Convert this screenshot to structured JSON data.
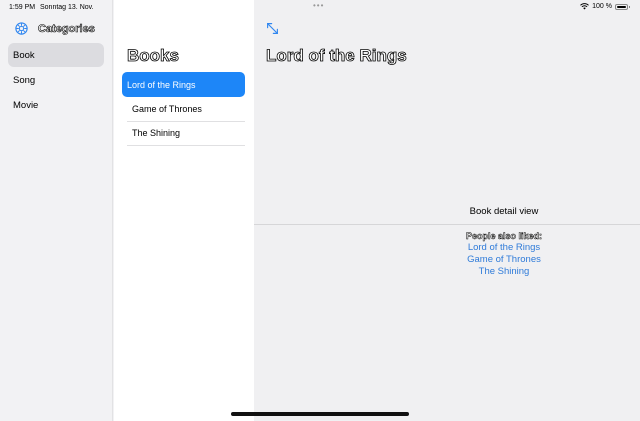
{
  "status_bar": {
    "time": "1:59 PM",
    "date": "Sonntag 13. Nov.",
    "battery": "100 %",
    "multitask_dots": "•••"
  },
  "sidebar": {
    "title": "Categories",
    "icon": "gear-icon",
    "items": [
      {
        "label": "Book",
        "selected": true
      },
      {
        "label": "Song",
        "selected": false
      },
      {
        "label": "Movie",
        "selected": false
      }
    ]
  },
  "books": {
    "title": "Books",
    "items": [
      {
        "label": "Lord of the Rings",
        "selected": true
      },
      {
        "label": "Game of Thrones",
        "selected": false
      },
      {
        "label": "The Shining",
        "selected": false
      }
    ]
  },
  "detail": {
    "title": "Lord of the Rings",
    "caption": "Book detail view",
    "related_label": "People also liked:",
    "related": [
      "Lord of the Rings",
      "Game of Thrones",
      "The Shining"
    ]
  },
  "colors": {
    "accent": "#1d86f8",
    "link": "#2f7bd9"
  }
}
